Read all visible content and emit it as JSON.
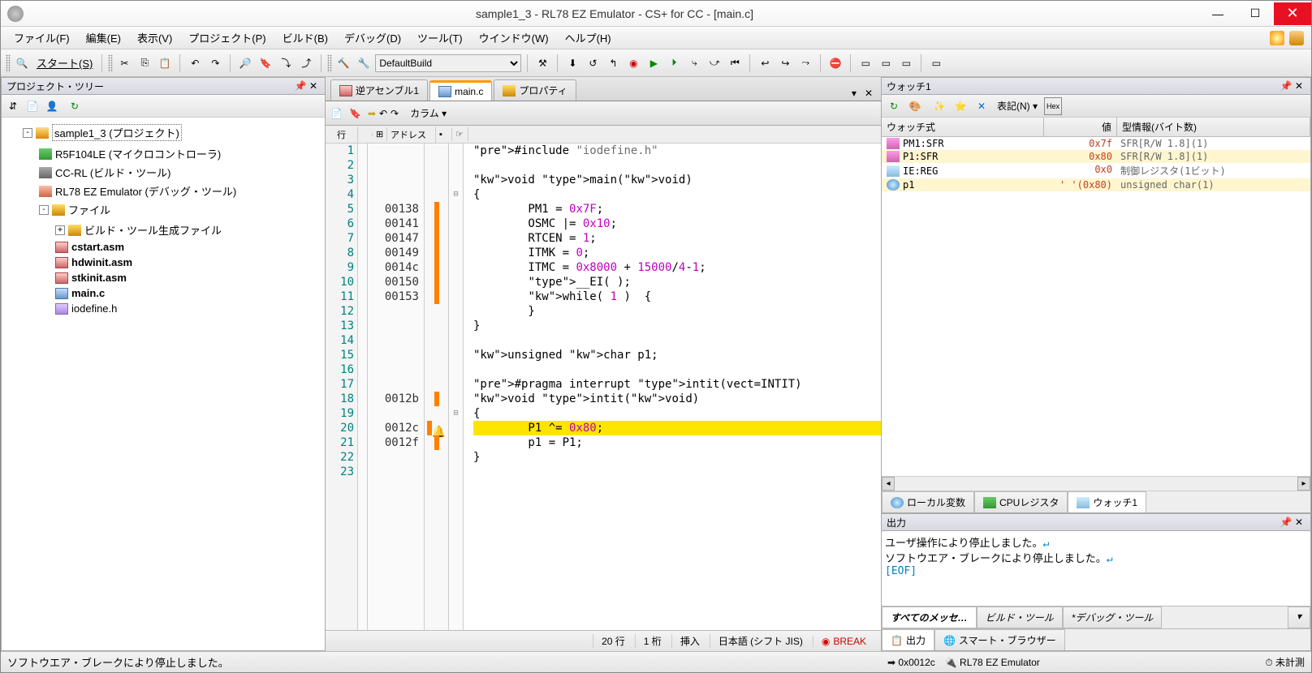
{
  "title": "sample1_3 - RL78 EZ Emulator - CS+ for CC - [main.c]",
  "menu": {
    "file": "ファイル(F)",
    "edit": "編集(E)",
    "view": "表示(V)",
    "project": "プロジェクト(P)",
    "build": "ビルド(B)",
    "debug": "デバッグ(D)",
    "tool": "ツール(T)",
    "window": "ウインドウ(W)",
    "help": "ヘルプ(H)"
  },
  "toolbar": {
    "start": "スタート(S)",
    "build_config": "DefaultBuild"
  },
  "tree": {
    "title": "プロジェクト・ツリー",
    "root": "sample1_3 (プロジェクト)",
    "mcu": "R5F104LE (マイクロコントローラ)",
    "ccrl": "CC-RL (ビルド・ツール)",
    "emulator": "RL78 EZ Emulator (デバッグ・ツール)",
    "files": "ファイル",
    "gen": "ビルド・ツール生成ファイル",
    "f1": "cstart.asm",
    "f2": "hdwinit.asm",
    "f3": "stkinit.asm",
    "f4": "main.c",
    "f5": "iodefine.h"
  },
  "editor": {
    "tab1": "逆アセンブル1",
    "tab2": "main.c",
    "tab3": "プロパティ",
    "column_label": "カラム",
    "col_line": "行",
    "col_addr": "アドレス",
    "lines": [
      {
        "n": 1,
        "addr": "",
        "code": "#include \"iodefine.h\""
      },
      {
        "n": 2,
        "addr": "",
        "code": ""
      },
      {
        "n": 3,
        "addr": "",
        "code": "void main(void)"
      },
      {
        "n": 4,
        "addr": "",
        "fold": "⊟",
        "code": "{"
      },
      {
        "n": 5,
        "addr": "00138",
        "bar": true,
        "code": "        PM1 = 0x7F;"
      },
      {
        "n": 6,
        "addr": "00141",
        "bar": true,
        "code": "        OSMC |= 0x10;"
      },
      {
        "n": 7,
        "addr": "00147",
        "bar": true,
        "code": "        RTCEN = 1;"
      },
      {
        "n": 8,
        "addr": "00149",
        "bar": true,
        "code": "        ITMK = 0;"
      },
      {
        "n": 9,
        "addr": "0014c",
        "bar": true,
        "code": "        ITMC = 0x8000 + 15000/4-1;"
      },
      {
        "n": 10,
        "addr": "00150",
        "bar": true,
        "code": "        __EI( );"
      },
      {
        "n": 11,
        "addr": "00153",
        "bar": true,
        "code": "        while( 1 )  {"
      },
      {
        "n": 12,
        "addr": "",
        "code": "        }"
      },
      {
        "n": 13,
        "addr": "",
        "code": "}"
      },
      {
        "n": 14,
        "addr": "",
        "code": ""
      },
      {
        "n": 15,
        "addr": "",
        "code": "unsigned char p1;"
      },
      {
        "n": 16,
        "addr": "",
        "code": ""
      },
      {
        "n": 17,
        "addr": "",
        "code": "#pragma interrupt intit(vect=INTIT)"
      },
      {
        "n": 18,
        "addr": "0012b",
        "bar": true,
        "code": "void intit(void)"
      },
      {
        "n": 19,
        "addr": "",
        "fold": "⊟",
        "code": "{"
      },
      {
        "n": 20,
        "addr": "0012c",
        "bar": true,
        "hl": true,
        "bp": true,
        "code": "        P1 ^= 0x80;"
      },
      {
        "n": 21,
        "addr": "0012f",
        "bar": true,
        "code": "        p1 = P1;"
      },
      {
        "n": 22,
        "addr": "",
        "code": "}"
      },
      {
        "n": 23,
        "addr": "",
        "code": ""
      }
    ]
  },
  "watch": {
    "title": "ウォッチ1",
    "notation": "表記(N)",
    "col_expr": "ウォッチ式",
    "col_val": "値",
    "col_type": "型情報(バイト数)",
    "rows": [
      {
        "name": "PM1:SFR",
        "val": "0x7f",
        "type": "SFR[R/W 1.8](1)",
        "icon": "sfr",
        "hl": false
      },
      {
        "name": "P1:SFR",
        "val": "0x80",
        "type": "SFR[R/W 1.8](1)",
        "icon": "sfr",
        "hl": true
      },
      {
        "name": "IE:REG",
        "val": "0x0",
        "type": "制御レジスタ(1ビット)",
        "icon": "reg",
        "hl": false
      },
      {
        "name": "p1",
        "val": "' '(0x80)",
        "type": "unsigned char(1)",
        "icon": "var",
        "hl": true
      }
    ],
    "tab_local": "ローカル変数",
    "tab_cpu": "CPUレジスタ",
    "tab_watch": "ウォッチ1"
  },
  "output": {
    "title": "出力",
    "line1": "ユーザ操作により停止しました。",
    "line2": "ソフトウエア・ブレークにより停止しました。",
    "eof": "[EOF]",
    "tab_all": "すべてのメッセ…",
    "tab_build": "ビルド・ツール",
    "tab_debug": "*デバッグ・ツール",
    "sub_output": "出力",
    "sub_browser": "スマート・ブラウザー"
  },
  "status": {
    "message": "ソフトウエア・ブレークにより停止しました。",
    "line": "20 行",
    "col": "1 桁",
    "ins": "挿入",
    "enc": "日本語 (シフト JIS)",
    "break": "BREAK",
    "pc": "0x0012c",
    "emu": "RL78 EZ Emulator",
    "time": "未計測"
  }
}
